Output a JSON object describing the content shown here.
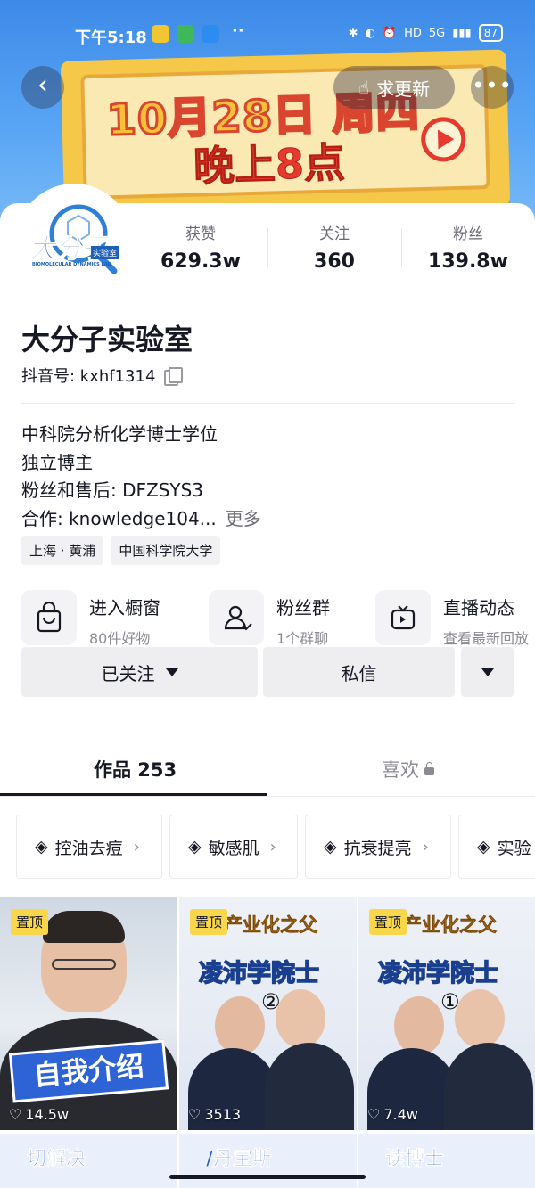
{
  "status_bar": {
    "time": "下午5:18",
    "extra": "··",
    "hd": "HD",
    "signal": "5G",
    "battery": "87"
  },
  "banner": {
    "date": "10月28日 周四",
    "time": "晚上8点"
  },
  "nav": {
    "back": "‹",
    "update_label": "求更新",
    "more": "•••"
  },
  "profile": {
    "avatar_text": "大分子",
    "avatar_small": "实验室",
    "avatar_caption": "BIOMOLECULAR DYNAMICS LAB",
    "name": "大分子实验室",
    "douyin_id": "抖音号: kxhf1314"
  },
  "stats": [
    {
      "label": "获赞",
      "value": "629.3w"
    },
    {
      "label": "关注",
      "value": "360"
    },
    {
      "label": "粉丝",
      "value": "139.8w"
    }
  ],
  "bio": {
    "lines": [
      "中科院分析化学博士学位",
      "独立博主",
      "粉丝和售后: DFZSYS3",
      "合作: knowledge104..."
    ],
    "more": "更多"
  },
  "tags": [
    "上海 · 黄浦",
    "中国科学院大学"
  ],
  "features": [
    {
      "title": "进入橱窗",
      "sub": "80件好物"
    },
    {
      "title": "粉丝群",
      "sub": "1个群聊"
    },
    {
      "title": "直播动态",
      "sub": "查看最新回放"
    }
  ],
  "actions": {
    "followed": "已关注",
    "message": "私信"
  },
  "tabs": {
    "works": "作品 253",
    "likes": "喜欢"
  },
  "collections": [
    "控油去痘",
    "敏感肌",
    "抗衰提亮",
    "实验"
  ],
  "videos": [
    {
      "pin": "置顶",
      "likes": "14.5w",
      "title": "自我介绍"
    },
    {
      "pin": "置顶",
      "likes": "3513",
      "headline": "产业化之父",
      "headline2": "凌沛学院士",
      "part": "②"
    },
    {
      "pin": "置顶",
      "likes": "7.4w",
      "headline": "产业化之父",
      "headline2": "凌沛学院士",
      "part": "①"
    }
  ],
  "row2": [
    "切解决",
    "/丹宝斯",
    "读博士"
  ],
  "colors": {
    "accent": "#161823",
    "pin_yellow": "#f8d84a",
    "banner_blue": "#4a97ee"
  }
}
